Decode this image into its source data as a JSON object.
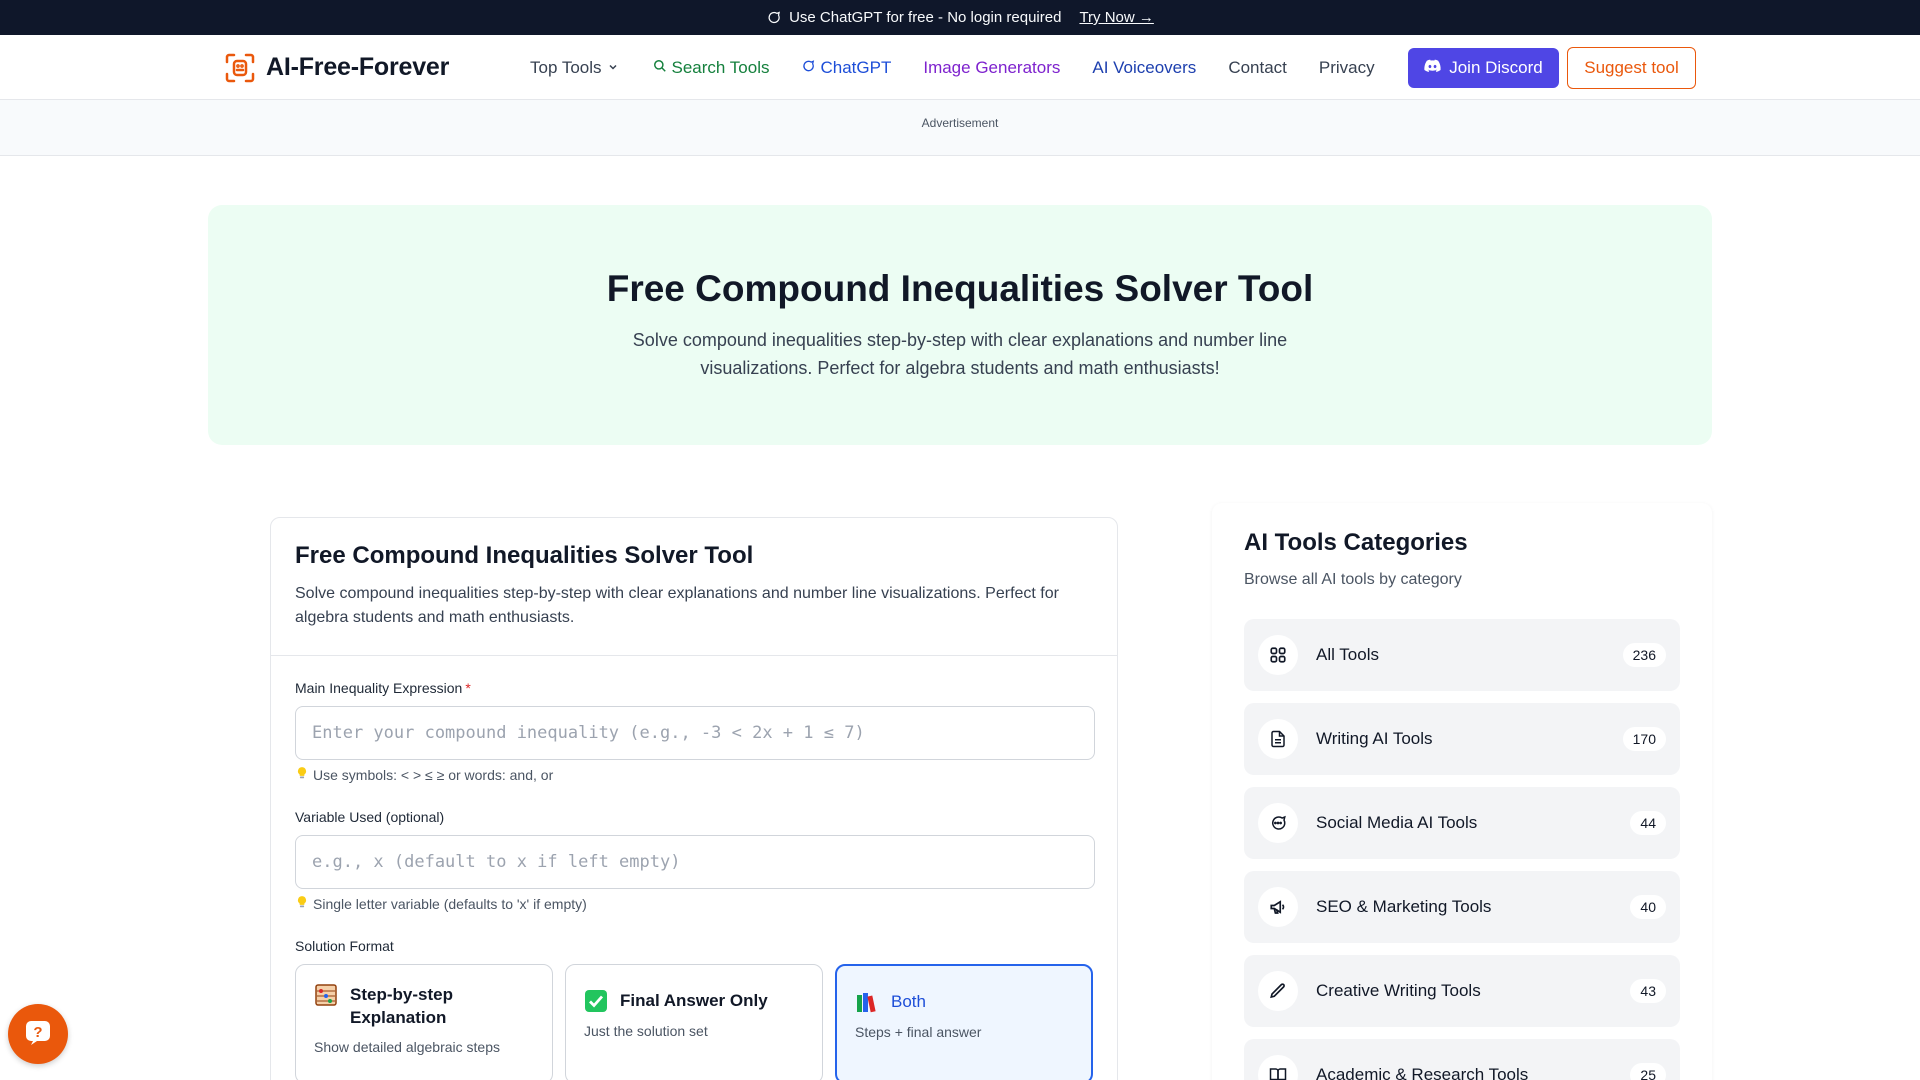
{
  "banner": {
    "text": "Use ChatGPT for free - No login required",
    "link": "Try Now →"
  },
  "nav": {
    "brand": "AI-Free-Forever",
    "links": {
      "top_tools": "Top Tools",
      "search_tools": "Search Tools",
      "chatgpt": "ChatGPT",
      "image_generators": "Image Generators",
      "ai_voiceovers": "AI Voiceovers",
      "contact": "Contact",
      "privacy": "Privacy"
    },
    "join_discord": "Join Discord",
    "suggest_tool": "Suggest tool"
  },
  "ad": {
    "label": "Advertisement"
  },
  "hero": {
    "title": "Free Compound Inequalities Solver Tool",
    "subtitle": "Solve compound inequalities step-by-step with clear explanations and number line visualizations. Perfect for algebra students and math enthusiasts!"
  },
  "tool": {
    "title": "Free Compound Inequalities Solver Tool",
    "description": "Solve compound inequalities step-by-step with clear explanations and number line visualizations. Perfect for algebra students and math enthusiasts.",
    "expression": {
      "label": "Main Inequality Expression",
      "required_mark": "*",
      "value": "",
      "placeholder": "Enter your compound inequality (e.g., -3 < 2x + 1 ≤ 7)",
      "hint": "Use symbols: < > ≤ ≥ or words: and, or"
    },
    "variable": {
      "label": "Variable Used (optional)",
      "value": "",
      "placeholder": "e.g., x (default to x if left empty)",
      "hint": "Single letter variable (defaults to 'x' if empty)"
    },
    "format": {
      "label": "Solution Format",
      "selected": "Both",
      "options": [
        {
          "title": "Step-by-step Explanation",
          "desc": "Show detailed algebraic steps"
        },
        {
          "title": "Final Answer Only",
          "desc": "Just the solution set"
        },
        {
          "title": "Both",
          "desc": "Steps + final answer"
        }
      ]
    }
  },
  "sidebar": {
    "title": "AI Tools Categories",
    "subtitle": "Browse all AI tools by category",
    "categories": [
      {
        "label": "All Tools",
        "count": "236",
        "icon": "grid-icon"
      },
      {
        "label": "Writing AI Tools",
        "count": "170",
        "icon": "document-icon"
      },
      {
        "label": "Social Media AI Tools",
        "count": "44",
        "icon": "chat-bubble-icon"
      },
      {
        "label": "SEO & Marketing Tools",
        "count": "40",
        "icon": "megaphone-icon"
      },
      {
        "label": "Creative Writing Tools",
        "count": "43",
        "icon": "pencil-icon"
      },
      {
        "label": "Academic & Research Tools",
        "count": "25",
        "icon": "book-icon"
      }
    ]
  },
  "colors": {
    "accent": "#ea580c",
    "discord": "#4f46e5",
    "selected": "#2563eb",
    "hero_bg": "#ecfdf3"
  }
}
